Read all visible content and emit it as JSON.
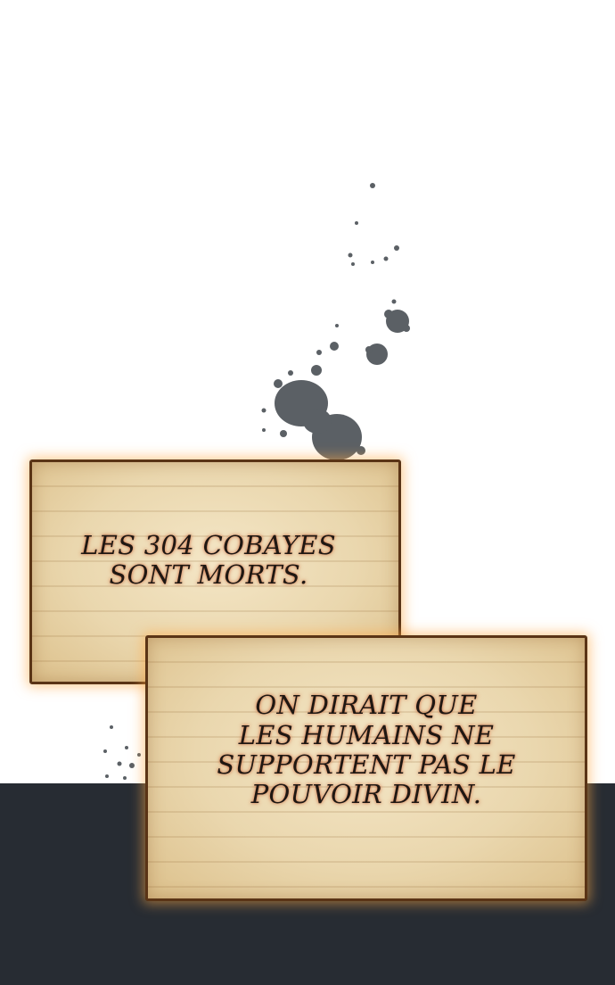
{
  "panel": {
    "note_1": {
      "lines": [
        "LES 304 COBAYES",
        "SONT MORTS."
      ]
    },
    "note_2": {
      "lines": [
        "ON DIRAIT QUE",
        "LES HUMAINS NE",
        "SUPPORTENT PAS LE",
        "POUVOIR DIVIN."
      ]
    }
  },
  "colors": {
    "background": "#ffffff",
    "dark_band": "#272c33",
    "paper": "#ead7ae",
    "paper_border": "#5a3416",
    "ink_splatter": "#5b6065",
    "text": "#1f1712"
  }
}
